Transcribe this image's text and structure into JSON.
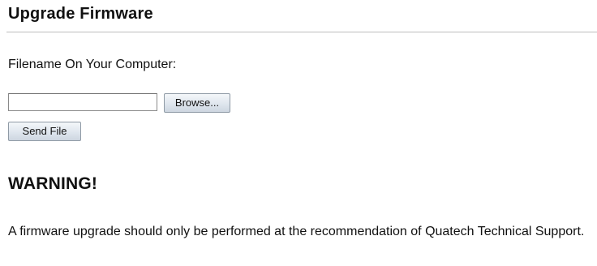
{
  "page": {
    "title": "Upgrade Firmware"
  },
  "upload": {
    "file_label": "Filename On Your Computer:",
    "file_value": "",
    "browse_label": "Browse...",
    "send_label": "Send File"
  },
  "warning": {
    "title": "WARNING!",
    "text": "A firmware upgrade should only be performed at the recommendation of Quatech Technical Support."
  }
}
